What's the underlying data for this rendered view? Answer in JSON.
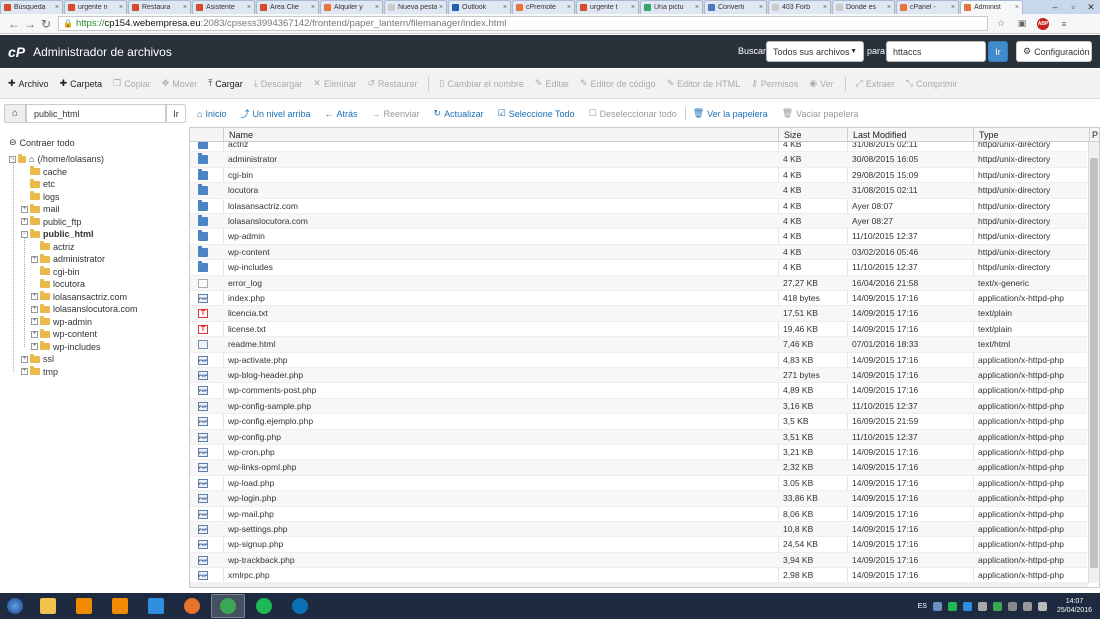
{
  "browser": {
    "tabs": [
      {
        "label": "Búsqueda",
        "color": "#d64b2a"
      },
      {
        "label": "urgente n",
        "color": "#d64b2a"
      },
      {
        "label": "Restaura",
        "color": "#d64b2a"
      },
      {
        "label": "Asistente",
        "color": "#d64b2a"
      },
      {
        "label": "Área Clie",
        "color": "#d64b2a"
      },
      {
        "label": "Alquiler y",
        "color": "#e8743b"
      },
      {
        "label": "Nueva pesta",
        "color": "#cccccc"
      },
      {
        "label": "Outlook",
        "color": "#1f5fae"
      },
      {
        "label": "cPremote",
        "color": "#e8743b"
      },
      {
        "label": "urgente t",
        "color": "#d64b2a"
      },
      {
        "label": "Una pictu",
        "color": "#38a36f"
      },
      {
        "label": "Converti",
        "color": "#4a7bc0"
      },
      {
        "label": "403 Forb",
        "color": "#cccccc"
      },
      {
        "label": "Donde es",
        "color": "#cccccc"
      },
      {
        "label": "cPanel -",
        "color": "#e8743b"
      },
      {
        "label": "Administ",
        "color": "#e8743b",
        "active": true
      }
    ],
    "url": {
      "proto": "https://",
      "host": "cp154.webempresa.eu",
      "path": ":2083/cpsess3994367142/frontend/paper_lantern/filemanager/index.html"
    },
    "abp": "ABP"
  },
  "header": {
    "logo": "cP",
    "title": "Administrador de archivos",
    "search_label": "Buscar",
    "search_scope": "Todos sus archivos",
    "para_label": "para",
    "search_value": "httaccs",
    "go_label": "Ir",
    "config_label": "Configuración"
  },
  "toolbar": {
    "archivo": "Archivo",
    "carpeta": "Carpeta",
    "copiar": "Copiar",
    "mover": "Mover",
    "cargar": "Cargar",
    "descargar": "Descargar",
    "eliminar": "Eliminar",
    "restaurar": "Restaurar",
    "renombrar": "Cambiar el nombre",
    "editar": "Editar",
    "editor_codigo": "Editor de código",
    "editor_html": "Editor de HTML",
    "permisos": "Permisos",
    "ver": "Ver",
    "extraer": "Extraer",
    "comprimir": "Comprimir"
  },
  "pathbar": {
    "path_value": "public_html",
    "go_label": "Ir",
    "inicio": "Inicio",
    "un_nivel": "Un nivel arriba",
    "atras": "Atrás",
    "reenviar": "Reenviar",
    "actualizar": "Actualizar",
    "seleccione_todo": "Seleccione Todo",
    "deseleccionar_todo": "Deseleccionar todo",
    "ver_papelera": "Ver la papelera",
    "vaciar_papelera": "Vaciar papelera"
  },
  "tree": {
    "collapse_all": "Contraer todo",
    "root": "(/home/lolasans)",
    "items": [
      {
        "label": "cache",
        "level": 1,
        "exp": false
      },
      {
        "label": "etc",
        "level": 1,
        "exp": false
      },
      {
        "label": "logs",
        "level": 1,
        "exp": false
      },
      {
        "label": "mail",
        "level": 1,
        "exp": "+"
      },
      {
        "label": "public_ftp",
        "level": 1,
        "exp": "+"
      },
      {
        "label": "public_html",
        "level": 1,
        "exp": "-",
        "bold": true
      },
      {
        "label": "actriz",
        "level": 2,
        "exp": false
      },
      {
        "label": "administrator",
        "level": 2,
        "exp": "+"
      },
      {
        "label": "cgi-bin",
        "level": 2,
        "exp": false
      },
      {
        "label": "locutora",
        "level": 2,
        "exp": false
      },
      {
        "label": "lolasansactriz.com",
        "level": 2,
        "exp": "+"
      },
      {
        "label": "lolasanslocutora.com",
        "level": 2,
        "exp": "+"
      },
      {
        "label": "wp-admin",
        "level": 2,
        "exp": "+"
      },
      {
        "label": "wp-content",
        "level": 2,
        "exp": "+"
      },
      {
        "label": "wp-includes",
        "level": 2,
        "exp": "+"
      },
      {
        "label": "ssl",
        "level": 1,
        "exp": "+"
      },
      {
        "label": "tmp",
        "level": 1,
        "exp": "+"
      }
    ]
  },
  "files": {
    "columns": {
      "name": "Name",
      "size": "Size",
      "modified": "Last Modified",
      "type": "Type",
      "extra": "P"
    },
    "rows": [
      {
        "name": "actriz",
        "size": "4 KB",
        "modified": "31/08/2015 02:11",
        "type": "httpd/unix-directory",
        "icon": "dir"
      },
      {
        "name": "administrator",
        "size": "4 KB",
        "modified": "30/08/2015 16:05",
        "type": "httpd/unix-directory",
        "icon": "dir"
      },
      {
        "name": "cgi-bin",
        "size": "4 KB",
        "modified": "29/08/2015 15:09",
        "type": "httpd/unix-directory",
        "icon": "dir"
      },
      {
        "name": "locutora",
        "size": "4 KB",
        "modified": "31/08/2015 02:11",
        "type": "httpd/unix-directory",
        "icon": "dir"
      },
      {
        "name": "lolasansactriz.com",
        "size": "4 KB",
        "modified": "Ayer 08:07",
        "type": "httpd/unix-directory",
        "icon": "dir"
      },
      {
        "name": "lolasanslocutora.com",
        "size": "4 KB",
        "modified": "Ayer 08:27",
        "type": "httpd/unix-directory",
        "icon": "dir"
      },
      {
        "name": "wp-admin",
        "size": "4 KB",
        "modified": "11/10/2015 12:37",
        "type": "httpd/unix-directory",
        "icon": "dir"
      },
      {
        "name": "wp-content",
        "size": "4 KB",
        "modified": "03/02/2016 05:46",
        "type": "httpd/unix-directory",
        "icon": "dir"
      },
      {
        "name": "wp-includes",
        "size": "4 KB",
        "modified": "11/10/2015 12:37",
        "type": "httpd/unix-directory",
        "icon": "dir"
      },
      {
        "name": "error_log",
        "size": "27,27 KB",
        "modified": "16/04/2016 21:58",
        "type": "text/x-generic",
        "icon": "gen"
      },
      {
        "name": "index.php",
        "size": "418 bytes",
        "modified": "14/09/2015 17:16",
        "type": "application/x-httpd-php",
        "icon": "php"
      },
      {
        "name": "licencia.txt",
        "size": "17,51 KB",
        "modified": "14/09/2015 17:16",
        "type": "text/plain",
        "icon": "txt"
      },
      {
        "name": "license.txt",
        "size": "19,46 KB",
        "modified": "14/09/2015 17:16",
        "type": "text/plain",
        "icon": "txt"
      },
      {
        "name": "readme.html",
        "size": "7,46 KB",
        "modified": "07/01/2016 18:33",
        "type": "text/html",
        "icon": "html"
      },
      {
        "name": "wp-activate.php",
        "size": "4,83 KB",
        "modified": "14/09/2015 17:16",
        "type": "application/x-httpd-php",
        "icon": "php"
      },
      {
        "name": "wp-blog-header.php",
        "size": "271 bytes",
        "modified": "14/09/2015 17:16",
        "type": "application/x-httpd-php",
        "icon": "php"
      },
      {
        "name": "wp-comments-post.php",
        "size": "4,89 KB",
        "modified": "14/09/2015 17:16",
        "type": "application/x-httpd-php",
        "icon": "php"
      },
      {
        "name": "wp-config-sample.php",
        "size": "3,16 KB",
        "modified": "11/10/2015 12:37",
        "type": "application/x-httpd-php",
        "icon": "php"
      },
      {
        "name": "wp-config.ejemplo.php",
        "size": "3,5 KB",
        "modified": "16/09/2015 21:59",
        "type": "application/x-httpd-php",
        "icon": "php"
      },
      {
        "name": "wp-config.php",
        "size": "3,51 KB",
        "modified": "11/10/2015 12:37",
        "type": "application/x-httpd-php",
        "icon": "php"
      },
      {
        "name": "wp-cron.php",
        "size": "3,21 KB",
        "modified": "14/09/2015 17:16",
        "type": "application/x-httpd-php",
        "icon": "php"
      },
      {
        "name": "wp-links-opml.php",
        "size": "2,32 KB",
        "modified": "14/09/2015 17:16",
        "type": "application/x-httpd-php",
        "icon": "php"
      },
      {
        "name": "wp-load.php",
        "size": "3,05 KB",
        "modified": "14/09/2015 17:16",
        "type": "application/x-httpd-php",
        "icon": "php"
      },
      {
        "name": "wp-login.php",
        "size": "33,86 KB",
        "modified": "14/09/2015 17:16",
        "type": "application/x-httpd-php",
        "icon": "php"
      },
      {
        "name": "wp-mail.php",
        "size": "8,06 KB",
        "modified": "14/09/2015 17:16",
        "type": "application/x-httpd-php",
        "icon": "php"
      },
      {
        "name": "wp-settings.php",
        "size": "10,8 KB",
        "modified": "14/09/2015 17:16",
        "type": "application/x-httpd-php",
        "icon": "php"
      },
      {
        "name": "wp-signup.php",
        "size": "24,54 KB",
        "modified": "14/09/2015 17:16",
        "type": "application/x-httpd-php",
        "icon": "php"
      },
      {
        "name": "wp-trackback.php",
        "size": "3,94 KB",
        "modified": "14/09/2015 17:16",
        "type": "application/x-httpd-php",
        "icon": "php"
      },
      {
        "name": "xmlrpc.php",
        "size": "2,98 KB",
        "modified": "14/09/2015 17:16",
        "type": "application/x-httpd-php",
        "icon": "php"
      }
    ]
  },
  "taskbar": {
    "apps": [
      {
        "name": "explorer-icon",
        "color": "#f2c14e"
      },
      {
        "name": "vlc-icon",
        "color": "#f08a00"
      },
      {
        "name": "media-player-icon",
        "color": "#f08a00"
      },
      {
        "name": "internet-explorer-icon",
        "color": "#2f8ee0"
      },
      {
        "name": "firefox-icon",
        "color": "#e8722a"
      },
      {
        "name": "chrome-icon",
        "color": "#3aa757",
        "active": true
      },
      {
        "name": "spotify-icon",
        "color": "#1db954"
      },
      {
        "name": "hp-icon",
        "color": "#0b6fb6"
      }
    ],
    "lang": "ES",
    "time": "14:07",
    "date": "25/04/2016"
  }
}
